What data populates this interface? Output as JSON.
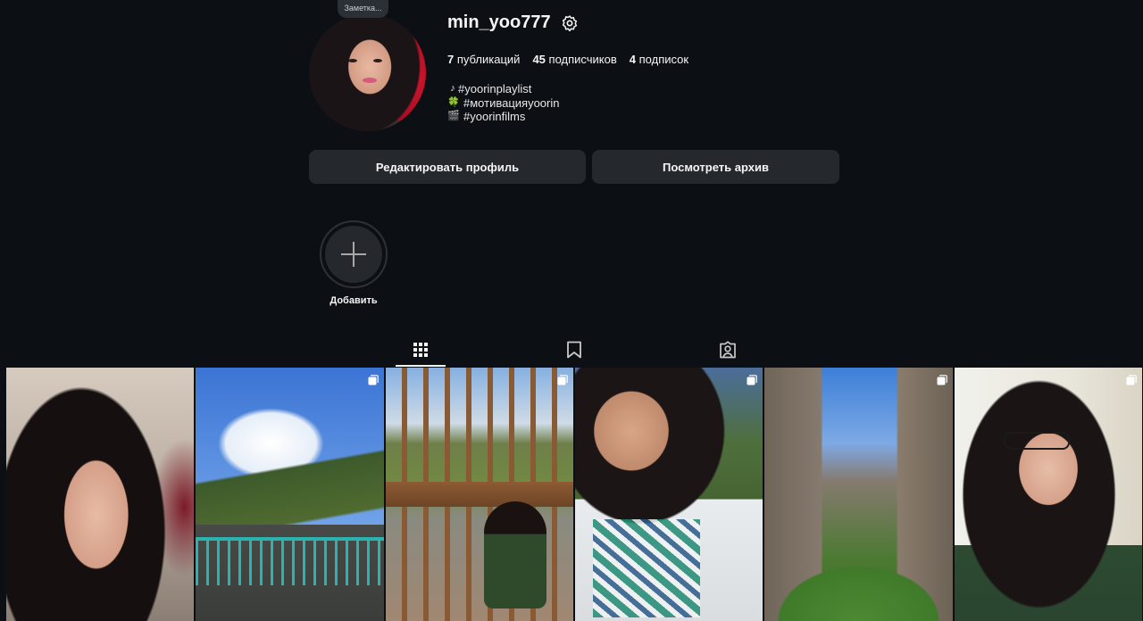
{
  "profile": {
    "note_label": "Заметка...",
    "username": "min_yoo777",
    "stats": {
      "posts_count": "7",
      "posts_label": "публикаций",
      "followers_count": "45",
      "followers_label": "подписчиков",
      "following_count": "4",
      "following_label": "подписок"
    },
    "bio": [
      {
        "icon": "♪",
        "icon_name": "music-note-icon",
        "text": "#yoorinplaylist"
      },
      {
        "icon": "🍀",
        "icon_name": "clover-icon",
        "text": "#мотивацияyoorin"
      },
      {
        "icon": "🎬",
        "icon_name": "clapperboard-icon",
        "text": "#yoorinfilms"
      }
    ]
  },
  "buttons": {
    "edit_profile": "Редактировать профиль",
    "view_archive": "Посмотреть архив"
  },
  "highlights": {
    "add_label": "Добавить"
  },
  "tabs": [
    {
      "name": "tab-posts",
      "icon": "grid-icon",
      "active": true
    },
    {
      "name": "tab-saved",
      "icon": "bookmark-icon",
      "active": false
    },
    {
      "name": "tab-tagged",
      "icon": "tagged-user-icon",
      "active": false
    }
  ],
  "posts": [
    {
      "name": "post-selfie-1",
      "multi": false
    },
    {
      "name": "post-mountain-railing",
      "multi": true
    },
    {
      "name": "post-balcony-chair",
      "multi": true
    },
    {
      "name": "post-selfie-sunglasses",
      "multi": true
    },
    {
      "name": "post-canyon",
      "multi": true
    },
    {
      "name": "post-selfie-glasses",
      "multi": true
    }
  ],
  "colors": {
    "background": "#0c1014",
    "button_bg": "#25292e",
    "text": "#f5f5f5"
  }
}
